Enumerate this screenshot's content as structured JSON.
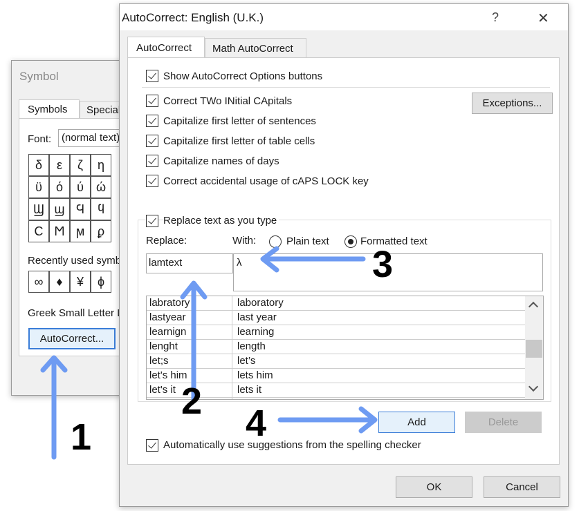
{
  "symbol_dialog": {
    "title": "Symbol",
    "tabs": [
      "Symbols",
      "Special"
    ],
    "font_label": "Font:",
    "font_value": "(normal text)",
    "symbols": [
      [
        "δ",
        "ε",
        "ζ",
        "η"
      ],
      [
        "ϋ",
        "ό",
        "ύ",
        "ώ"
      ],
      [
        "Ϣ",
        "ϣ",
        "Ϥ",
        "ϥ"
      ],
      [
        "Ϲ",
        "Ϻ",
        "ϻ",
        "ϼ"
      ]
    ],
    "recent_label": "Recently used symbols:",
    "recent": [
      "∞",
      "♦",
      "¥",
      "ϕ"
    ],
    "char_name": "Greek Small Letter Lamda",
    "autocorrect_button": "AutoCorrect..."
  },
  "autocorrect_dialog": {
    "title": "AutoCorrect: English (U.K.)",
    "help": "?",
    "close": "✕",
    "tabs": [
      "AutoCorrect",
      "Math AutoCorrect"
    ],
    "options": [
      "Show AutoCorrect Options buttons",
      "Correct TWo INitial CApitals",
      "Capitalize first letter of sentences",
      "Capitalize first letter of table cells",
      "Capitalize names of days",
      "Correct accidental usage of cAPS LOCK key"
    ],
    "exceptions_button": "Exceptions...",
    "replace_group": "Replace text as you type",
    "replace_label": "Replace:",
    "with_label": "With:",
    "plain_text": "Plain text",
    "formatted_text": "Formatted text",
    "selected_format": "Formatted text",
    "replace_value": "lamtext",
    "with_value": "λ",
    "entries": [
      [
        "labratory",
        "laboratory"
      ],
      [
        "lastyear",
        "last year"
      ],
      [
        "learnign",
        "learning"
      ],
      [
        "lenght",
        "length"
      ],
      [
        "let;s",
        "let’s"
      ],
      [
        "let's him",
        "lets him"
      ],
      [
        "let's it",
        "lets it"
      ]
    ],
    "add_button": "Add",
    "delete_button": "Delete",
    "spelling_option": "Automatically use suggestions from the spelling checker",
    "ok_button": "OK",
    "cancel_button": "Cancel"
  },
  "annotations": {
    "steps": [
      "1",
      "2",
      "3",
      "4"
    ],
    "arrow_color": "#6e9bf2"
  }
}
